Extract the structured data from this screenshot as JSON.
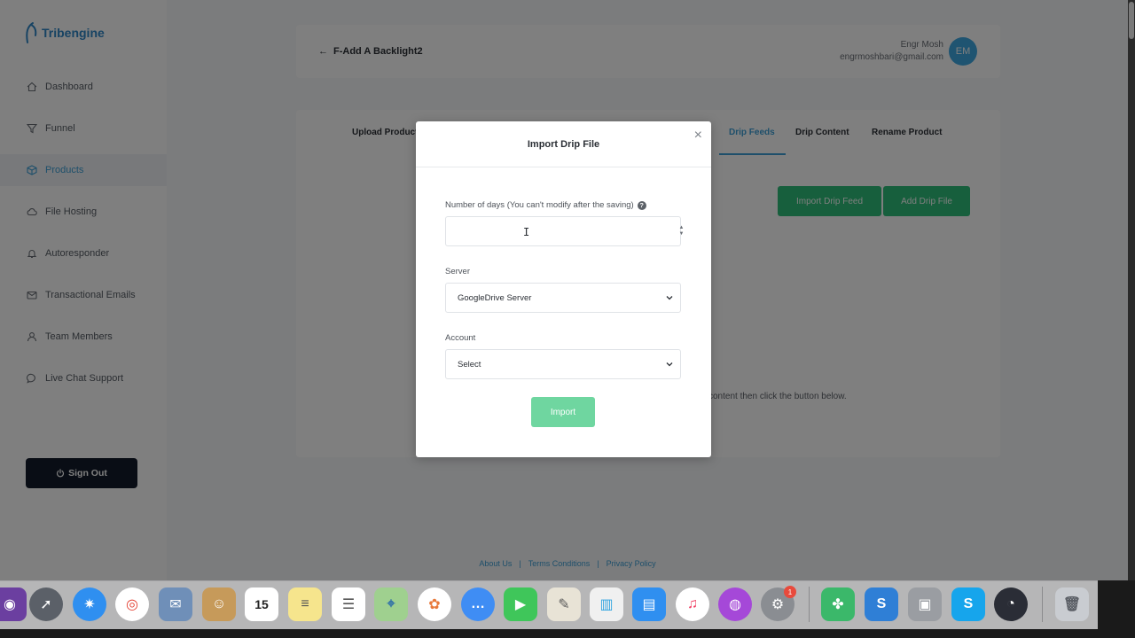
{
  "app": {
    "logo_text": "Tribengine",
    "page_title": "F-Add A Backlight2",
    "user": {
      "name": "Engr Mosh",
      "email": "engrmoshbari@gmail.com",
      "initials": "EM"
    }
  },
  "sidebar": {
    "items": [
      {
        "label": "Dashboard",
        "icon": "home-icon"
      },
      {
        "label": "Funnel",
        "icon": "funnel-icon"
      },
      {
        "label": "Products",
        "icon": "cube-icon",
        "active": true
      },
      {
        "label": "File Hosting",
        "icon": "cloud-icon"
      },
      {
        "label": "Autoresponder",
        "icon": "bell-icon"
      },
      {
        "label": "Transactional Emails",
        "icon": "mail-icon"
      },
      {
        "label": "Team Members",
        "icon": "user-icon"
      },
      {
        "label": "Live Chat Support",
        "icon": "chat-icon"
      }
    ],
    "signout_label": "Sign Out"
  },
  "tabs": [
    {
      "label": "Upload Product"
    },
    {
      "label": "Drip Feeds",
      "active": true
    },
    {
      "label": "Drip Content"
    },
    {
      "label": "Rename Product"
    }
  ],
  "actions": {
    "import_drip_feed": "Import Drip Feed",
    "add_drip_file": "Add Drip File"
  },
  "hint_text": "content then click the button below.",
  "footer": {
    "about": "About Us",
    "terms": "Terms Conditions",
    "privacy": "Privacy Policy",
    "separator": "|"
  },
  "modal": {
    "title": "Import Drip File",
    "close_symbol": "×",
    "days_label": "Number of days (You can't modify after the saving)",
    "days_value": "",
    "server_label": "Server",
    "server_value": "GoogleDrive Server",
    "account_label": "Account",
    "account_value": "Select",
    "import_label": "Import"
  },
  "dock": {
    "badge_count": "1"
  },
  "colors": {
    "accent": "#3c9fd6",
    "green": "#2fbe7a",
    "import_green": "#6fd6a0",
    "signout_bg": "#121a2b"
  }
}
